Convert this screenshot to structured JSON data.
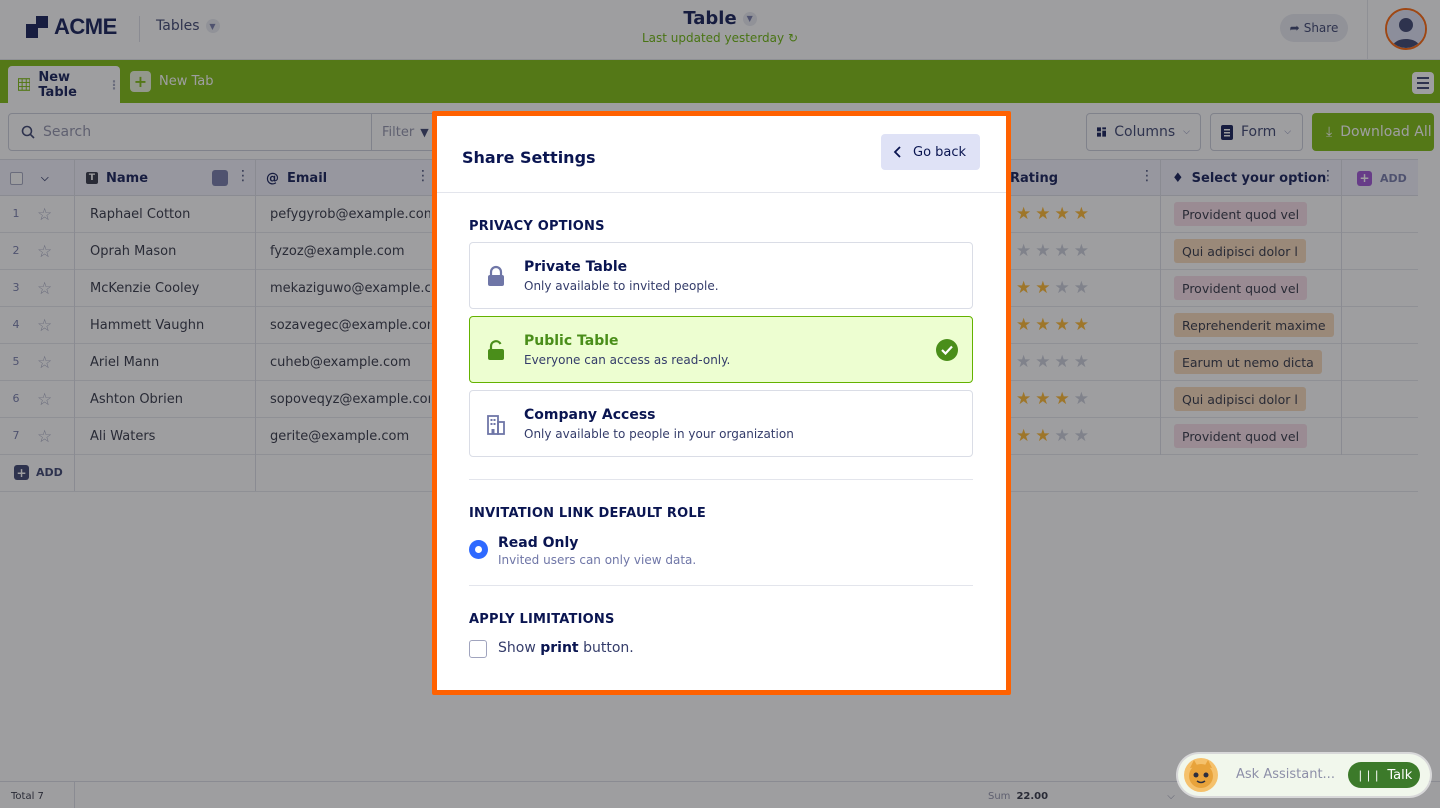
{
  "header": {
    "logo_text": "ACME",
    "tables_label": "Tables",
    "title": "Table",
    "updated": "Last updated yesterday",
    "share_label": "Share"
  },
  "tabs": {
    "active_label": "New Table",
    "new_label": "New Tab"
  },
  "toolbar": {
    "search_placeholder": "Search",
    "filter_label": "Filter",
    "columns_label": "Columns",
    "form_label": "Form",
    "download_label": "Download All"
  },
  "table": {
    "headers": {
      "name": "Name",
      "email": "Email",
      "rating": "Rating",
      "option": "Select your option",
      "add": "ADD"
    },
    "rows": [
      {
        "num": "1",
        "name": "Raphael Cotton",
        "email": "pefygyrob@example.com",
        "rating": 4,
        "option": "Provident quod vel",
        "option_color": "#f8dde7"
      },
      {
        "num": "2",
        "name": "Oprah Mason",
        "email": "fyzoz@example.com",
        "rating": 0,
        "option": "Qui adipisci dolor l",
        "option_color": "#f8d9b8"
      },
      {
        "num": "3",
        "name": "McKenzie Cooley",
        "email": "mekaziguwo@example.c...",
        "rating": 2,
        "option": "Provident quod vel",
        "option_color": "#f8dde7"
      },
      {
        "num": "4",
        "name": "Hammett Vaughn",
        "email": "sozavegec@example.com",
        "rating": 4,
        "option": "Reprehenderit maxime",
        "option_color": "#f8d9b8"
      },
      {
        "num": "5",
        "name": "Ariel Mann",
        "email": "cuheb@example.com",
        "rating": 0,
        "option": "Earum ut nemo dicta",
        "option_color": "#f8d9b8"
      },
      {
        "num": "6",
        "name": "Ashton Obrien",
        "email": "sopoveqyz@example.com",
        "rating": 3,
        "option": "Qui adipisci dolor l",
        "option_color": "#f8d9b8"
      },
      {
        "num": "7",
        "name": "Ali Waters",
        "email": "gerite@example.com",
        "rating": 2,
        "option": "Provident quod vel",
        "option_color": "#f8dde7"
      }
    ],
    "add_row_label": "ADD"
  },
  "footer": {
    "total": "Total 7",
    "sum_label": "Sum",
    "sum_value": "22.00"
  },
  "assistant": {
    "placeholder": "Ask Assistant...",
    "talk_label": "Talk"
  },
  "modal": {
    "title": "Share Settings",
    "go_back": "Go back",
    "privacy_heading": "PRIVACY OPTIONS",
    "options": [
      {
        "title": "Private Table",
        "desc": "Only available to invited people.",
        "icon": "lock-icon"
      },
      {
        "title": "Public Table",
        "desc": "Everyone can access as read-only.",
        "icon": "unlock-icon",
        "selected": true
      },
      {
        "title": "Company Access",
        "desc": "Only available to people in your organization",
        "icon": "building-icon"
      }
    ],
    "role_heading": "INVITATION LINK DEFAULT ROLE",
    "role_title": "Read Only",
    "role_desc": "Invited users can only view data.",
    "limits_heading": "APPLY LIMITATIONS",
    "print_prefix": "Show ",
    "print_bold": "print",
    "print_suffix": " button."
  },
  "colors": {
    "accent_green": "#78bb07",
    "modal_border": "#ff6100",
    "selected_bg": "#edfed1",
    "radio_blue": "#2e69ff"
  }
}
